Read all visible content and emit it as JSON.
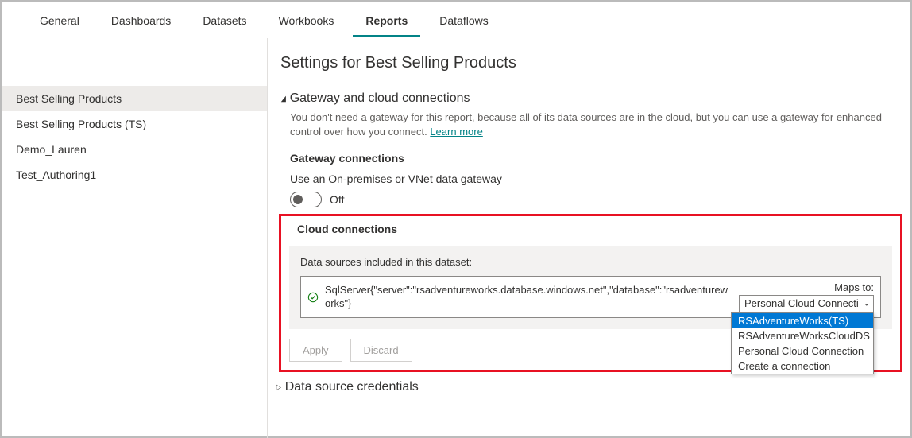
{
  "tabs": [
    {
      "label": "General"
    },
    {
      "label": "Dashboards"
    },
    {
      "label": "Datasets"
    },
    {
      "label": "Workbooks"
    },
    {
      "label": "Reports",
      "active": true
    },
    {
      "label": "Dataflows"
    }
  ],
  "sidebar": {
    "items": [
      {
        "label": "Best Selling Products",
        "active": true
      },
      {
        "label": "Best Selling Products (TS)"
      },
      {
        "label": "Demo_Lauren"
      },
      {
        "label": "Test_Authoring1"
      }
    ]
  },
  "page_title": "Settings for Best Selling Products",
  "gateway_section": {
    "title": "Gateway and cloud connections",
    "desc_prefix": "You don't need a gateway for this report, because all of its data sources are in the cloud, but you can use a gateway for enhanced control over how you connect. ",
    "learn_more": "Learn more",
    "gateway_connections_title": "Gateway connections",
    "gateway_row_text": "Use an On-premises or VNet data gateway",
    "toggle_label": "Off"
  },
  "cloud": {
    "title": "Cloud connections",
    "included_label": "Data sources included in this dataset:",
    "datasource_text": "SqlServer{\"server\":\"rsadventureworks.database.windows.net\",\"database\":\"rsadventureworks\"}",
    "maps_to_label": "Maps to:",
    "selected_value": "Personal Cloud Connecti",
    "dropdown": [
      "RSAdventureWorks(TS)",
      "RSAdventureWorksCloudDS",
      "Personal Cloud Connection",
      "Create a connection"
    ],
    "dropdown_selected_index": 0,
    "apply": "Apply",
    "discard": "Discard"
  },
  "credentials_title": "Data source credentials"
}
